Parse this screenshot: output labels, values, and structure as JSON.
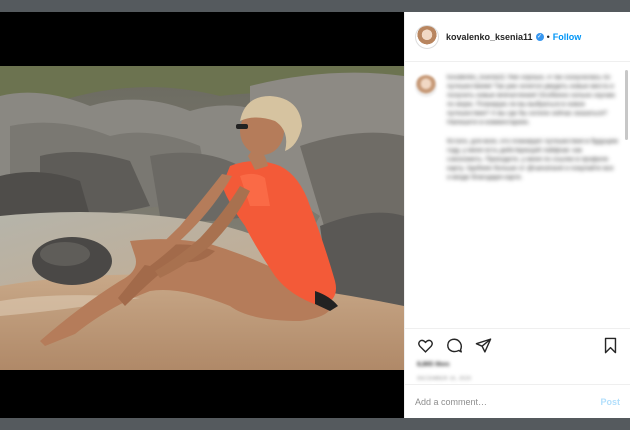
{
  "header": {
    "username": "kovalenko_ksenia11",
    "verified_icon": "verified-badge-icon",
    "separator": "•",
    "follow_label": "Follow"
  },
  "caption": {
    "text": "kovalenko_ksenia11 Уже хорошо, я так соскучилась по путешествиям! Так уже хочется увидеть новые места и получить новые впечатления! Особенно сильно скучаю по морю. Планирую ли вы выбраться в новое путешествие? А вы где бы хотели сейчас оказаться? Напишите в комментариях.",
    "text2": "Кстати, для всех, кто планирует путешествия в будущем году, у меня есть действующий лайфхак: как сэкономить. Приходите, у меня по ссылке в профиле карту. Удобнее больше от @sanutravel и покупайте все и везде благодаря карте."
  },
  "actions": {
    "like_icon": "heart-icon",
    "comment_icon": "comment-icon",
    "share_icon": "share-icon",
    "save_icon": "bookmark-icon"
  },
  "likes": "8,865 likes",
  "date": "DECEMBER 16, 2020",
  "add_comment": {
    "placeholder": "Add a comment…",
    "post_label": "Post"
  },
  "colors": {
    "accent": "#0095f6",
    "post_disabled": "#b2dffc",
    "backdrop": "#555a5e"
  }
}
